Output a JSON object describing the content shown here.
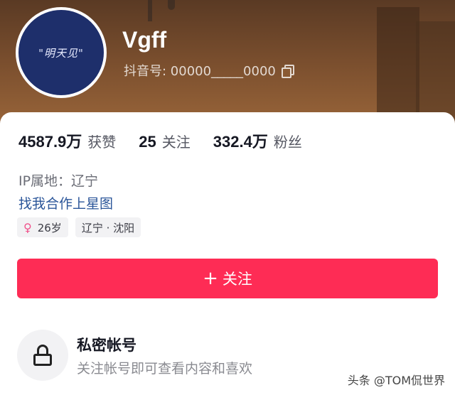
{
  "profile": {
    "avatar_text": "\"明天见\"",
    "username": "Vgff",
    "douyin_id_label": "抖音号: 00000_____0000",
    "copy_icon": "copy-icon"
  },
  "stats": [
    {
      "value": "4587.9万",
      "label": "获赞"
    },
    {
      "value": "25",
      "label": "关注"
    },
    {
      "value": "332.4万",
      "label": "粉丝"
    }
  ],
  "info": {
    "ip_location": "IP属地：辽宁",
    "cooperate_link": "找我合作上星图"
  },
  "tags": {
    "gender_icon": "female-icon",
    "age": "26岁",
    "location": "辽宁 · 沈阳"
  },
  "follow_button": {
    "icon": "plus-icon",
    "label": "关注"
  },
  "private_account": {
    "icon": "lock-icon",
    "title": "私密帐号",
    "description": "关注帐号即可查看内容和喜欢"
  },
  "watermark": "头条 @TOM侃世界",
  "colors": {
    "accent": "#fe2c55",
    "link": "#2a5599",
    "avatar_bg": "#1e2f6b",
    "female": "#f0508a"
  }
}
